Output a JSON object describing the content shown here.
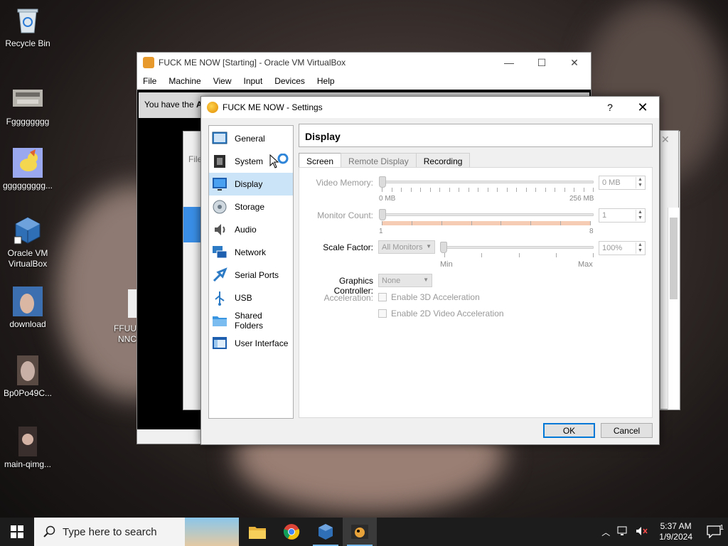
{
  "desktop": {
    "icons": [
      {
        "label": "Recycle Bin"
      },
      {
        "label": "Fgggggggg"
      },
      {
        "label": "ggggggggg..."
      },
      {
        "label": "Oracle VM VirtualBox"
      },
      {
        "label": "download"
      },
      {
        "label": "Bp0Po49C..."
      },
      {
        "label": "main-qimg..."
      }
    ],
    "stray_label_1": "FFUU(",
    "stray_label_2": "NNC"
  },
  "vm_window": {
    "title": "FUCK ME NOW [Starting] - Oracle VM VirtualBox",
    "menu": [
      "File",
      "Machine",
      "View",
      "Input",
      "Devices",
      "Help"
    ],
    "notice_prefix": "You have the ",
    "notice_bold": "Au",
    "inner_menu_peek": "File"
  },
  "settings": {
    "title": "FUCK ME NOW - Settings",
    "help_glyph": "?",
    "close_glyph": "✕",
    "sidebar": [
      {
        "label": "General",
        "icon": "general-icon"
      },
      {
        "label": "System",
        "icon": "system-icon"
      },
      {
        "label": "Display",
        "icon": "display-icon",
        "active": true
      },
      {
        "label": "Storage",
        "icon": "storage-icon"
      },
      {
        "label": "Audio",
        "icon": "audio-icon"
      },
      {
        "label": "Network",
        "icon": "network-icon"
      },
      {
        "label": "Serial Ports",
        "icon": "serial-ports-icon"
      },
      {
        "label": "USB",
        "icon": "usb-icon"
      },
      {
        "label": "Shared Folders",
        "icon": "shared-folders-icon"
      },
      {
        "label": "User Interface",
        "icon": "user-interface-icon"
      }
    ],
    "section_title": "Display",
    "tabs": [
      "Screen",
      "Remote Display",
      "Recording"
    ],
    "active_tab": "Screen",
    "video_memory": {
      "label": "Video Memory:",
      "min": "0 MB",
      "max": "256 MB",
      "value": "0 MB"
    },
    "monitor_count": {
      "label": "Monitor Count:",
      "min": "1",
      "max": "8",
      "value": "1"
    },
    "scale_factor": {
      "label": "Scale Factor:",
      "combo": "All Monitors",
      "min": "Min",
      "max": "Max",
      "value": "100%"
    },
    "graphics_controller": {
      "label": "Graphics Controller:",
      "value": "None"
    },
    "acceleration": {
      "label": "Acceleration:",
      "enable_3d": "Enable 3D Acceleration",
      "enable_2d": "Enable 2D Video Acceleration"
    },
    "ok_label": "OK",
    "cancel_label": "Cancel"
  },
  "taskbar": {
    "search_placeholder": "Type here to search",
    "time": "5:37 AM",
    "date": "1/9/2024",
    "notification_count": "1"
  },
  "colors": {
    "accent": "#0078d7",
    "selected_bg": "#cce4f7",
    "taskbar": "#1c1c1c"
  }
}
